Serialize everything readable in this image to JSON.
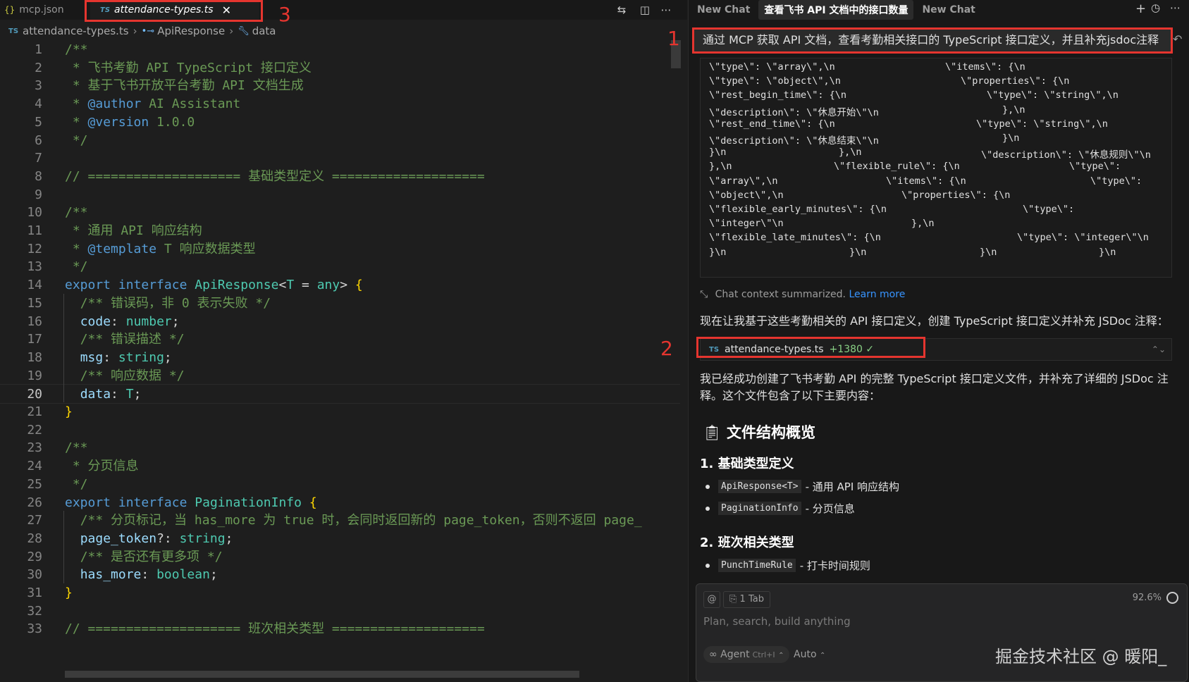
{
  "editor": {
    "tabs": [
      {
        "label": "mcp.json",
        "icon": "json-braces-icon"
      },
      {
        "label": "attendance-types.ts",
        "icon": "typescript-icon",
        "active": true
      }
    ],
    "tab_close": "✕",
    "icons": [
      "compare-changes-icon",
      "split-editor-icon",
      "more-actions-icon"
    ],
    "breadcrumb": {
      "file": "attendance-types.ts",
      "symbol1": "ApiResponse",
      "symbol2": "data",
      "ts_badge": "TS"
    },
    "current_line": 20,
    "lines": [
      {
        "n": 1,
        "tokens": [
          [
            "c",
            "/**"
          ]
        ]
      },
      {
        "n": 2,
        "tokens": [
          [
            "c",
            " * 飞书考勤 API TypeScript 接口定义"
          ]
        ]
      },
      {
        "n": 3,
        "tokens": [
          [
            "c",
            " * 基于飞书开放平台考勤 API 文档生成"
          ]
        ]
      },
      {
        "n": 4,
        "tokens": [
          [
            "c",
            " * "
          ],
          [
            "doc",
            "@author"
          ],
          [
            "c",
            " AI Assistant"
          ]
        ]
      },
      {
        "n": 5,
        "tokens": [
          [
            "c",
            " * "
          ],
          [
            "doc",
            "@version"
          ],
          [
            "c",
            " 1.0.0"
          ]
        ]
      },
      {
        "n": 6,
        "tokens": [
          [
            "c",
            " */"
          ]
        ]
      },
      {
        "n": 7,
        "tokens": []
      },
      {
        "n": 8,
        "tokens": [
          [
            "c",
            "// ==================== 基础类型定义 ===================="
          ]
        ]
      },
      {
        "n": 9,
        "tokens": []
      },
      {
        "n": 10,
        "tokens": [
          [
            "c",
            "/**"
          ]
        ]
      },
      {
        "n": 11,
        "tokens": [
          [
            "c",
            " * 通用 API 响应结构"
          ]
        ]
      },
      {
        "n": 12,
        "tokens": [
          [
            "c",
            " * "
          ],
          [
            "doc",
            "@template"
          ],
          [
            "c",
            " T 响应数据类型"
          ]
        ]
      },
      {
        "n": 13,
        "tokens": [
          [
            "c",
            " */"
          ]
        ]
      },
      {
        "n": 14,
        "tokens": [
          [
            "k",
            "export"
          ],
          [
            "p",
            " "
          ],
          [
            "k",
            "interface"
          ],
          [
            "p",
            " "
          ],
          [
            "t",
            "ApiResponse"
          ],
          [
            "p",
            "<"
          ],
          [
            "t",
            "T"
          ],
          [
            "p",
            " = "
          ],
          [
            "t",
            "any"
          ],
          [
            "p",
            "> "
          ],
          [
            "b",
            "{"
          ]
        ]
      },
      {
        "n": 15,
        "tokens": [
          [
            "p",
            "  "
          ],
          [
            "c",
            "/** 错误码，非 0 表示失败 */"
          ]
        ]
      },
      {
        "n": 16,
        "tokens": [
          [
            "p",
            "  "
          ],
          [
            "v",
            "code"
          ],
          [
            "p",
            ": "
          ],
          [
            "t",
            "number"
          ],
          [
            "p",
            ";"
          ]
        ]
      },
      {
        "n": 17,
        "tokens": [
          [
            "p",
            "  "
          ],
          [
            "c",
            "/** 错误描述 */"
          ]
        ]
      },
      {
        "n": 18,
        "tokens": [
          [
            "p",
            "  "
          ],
          [
            "v",
            "msg"
          ],
          [
            "p",
            ": "
          ],
          [
            "t",
            "string"
          ],
          [
            "p",
            ";"
          ]
        ]
      },
      {
        "n": 19,
        "tokens": [
          [
            "p",
            "  "
          ],
          [
            "c",
            "/** 响应数据 */"
          ]
        ]
      },
      {
        "n": 20,
        "tokens": [
          [
            "p",
            "  "
          ],
          [
            "v",
            "data"
          ],
          [
            "p",
            ": "
          ],
          [
            "t",
            "T"
          ],
          [
            "p",
            ";"
          ]
        ]
      },
      {
        "n": 21,
        "tokens": [
          [
            "b",
            "}"
          ]
        ]
      },
      {
        "n": 22,
        "tokens": []
      },
      {
        "n": 23,
        "tokens": [
          [
            "c",
            "/**"
          ]
        ]
      },
      {
        "n": 24,
        "tokens": [
          [
            "c",
            " * 分页信息"
          ]
        ]
      },
      {
        "n": 25,
        "tokens": [
          [
            "c",
            " */"
          ]
        ]
      },
      {
        "n": 26,
        "tokens": [
          [
            "k",
            "export"
          ],
          [
            "p",
            " "
          ],
          [
            "k",
            "interface"
          ],
          [
            "p",
            " "
          ],
          [
            "t",
            "PaginationInfo"
          ],
          [
            "p",
            " "
          ],
          [
            "b",
            "{"
          ]
        ]
      },
      {
        "n": 27,
        "tokens": [
          [
            "p",
            "  "
          ],
          [
            "c",
            "/** 分页标记，当 has_more 为 true 时，会同时返回新的 page_token，否则不返回 page_"
          ]
        ]
      },
      {
        "n": 28,
        "tokens": [
          [
            "p",
            "  "
          ],
          [
            "v",
            "page_token"
          ],
          [
            "p",
            "?: "
          ],
          [
            "t",
            "string"
          ],
          [
            "p",
            ";"
          ]
        ]
      },
      {
        "n": 29,
        "tokens": [
          [
            "p",
            "  "
          ],
          [
            "c",
            "/** 是否还有更多项 */"
          ]
        ]
      },
      {
        "n": 30,
        "tokens": [
          [
            "p",
            "  "
          ],
          [
            "v",
            "has_more"
          ],
          [
            "p",
            ": "
          ],
          [
            "t",
            "boolean"
          ],
          [
            "p",
            ";"
          ]
        ]
      },
      {
        "n": 31,
        "tokens": [
          [
            "b",
            "}"
          ]
        ]
      },
      {
        "n": 32,
        "tokens": []
      },
      {
        "n": 33,
        "tokens": [
          [
            "c",
            "// ==================== 班次相关类型 ===================="
          ]
        ]
      }
    ]
  },
  "annotations": {
    "n1": "1",
    "n2": "2",
    "n3": "3"
  },
  "chat": {
    "tabs": [
      {
        "label": "New Chat"
      },
      {
        "label": "查看飞书 API 文档中的接口数量",
        "active": true
      },
      {
        "label": "New Chat"
      }
    ],
    "icons": [
      "plus-icon",
      "history-icon",
      "more-icon"
    ],
    "prompt": "通过 MCP 获取 API 文档，查看考勤相关接口的 TypeScript 接口定义，并且补充jsdoc注释",
    "tool_output": [
      [
        [
          0,
          "\\\"type\\\": \\\"array\\\",\\n"
        ],
        [
          335,
          "\\\"items\\\": {\\n"
        ]
      ],
      [
        [
          0,
          "\\\"type\\\": \\\"object\\\",\\n"
        ],
        [
          357,
          "\\\"properties\\\": {\\n"
        ]
      ],
      [
        [
          0,
          "\\\"rest_begin_time\\\": {\\n"
        ],
        [
          394,
          "\\\"type\\\": \\\"string\\\",\\n"
        ]
      ],
      [
        [
          0,
          "\\\"description\\\": \\\"休息开始\\\"\\n"
        ],
        [
          416,
          "},\\n"
        ]
      ],
      [
        [
          0,
          "\\\"rest_end_time\\\": {\\n"
        ],
        [
          379,
          "\\\"type\\\": \\\"string\\\",\\n"
        ]
      ],
      [
        [
          0,
          "\\\"description\\\": \\\"休息结束\\\"\\n"
        ],
        [
          416,
          "}\\n"
        ]
      ],
      [
        [
          0,
          "}\\n"
        ],
        [
          184,
          "},\\n"
        ],
        [
          386,
          "\\\"description\\\": \\\"休息规则\\\"\\n"
        ]
      ],
      [
        [
          0,
          "},\\n"
        ],
        [
          177,
          "\\\"flexible_rule\\\": {\\n"
        ],
        [
          511,
          "\\\"type\\\":"
        ]
      ],
      [
        [
          0,
          "\\\"array\\\",\\n"
        ],
        [
          251,
          "\\\"items\\\": {\\n"
        ],
        [
          541,
          "\\\"type\\\":"
        ]
      ],
      [
        [
          0,
          "\\\"object\\\",\\n"
        ],
        [
          273,
          "\\\"properties\\\": {\\n"
        ]
      ],
      [
        [
          0,
          "\\\"flexible_early_minutes\\\": {\\n"
        ],
        [
          445,
          "\\\"type\\\":"
        ]
      ],
      [
        [
          0,
          "\\\"integer\\\"\\n"
        ],
        [
          287,
          "},\\n"
        ]
      ],
      [
        [
          0,
          "\\\"flexible_late_minutes\\\": {\\n"
        ],
        [
          437,
          "\\\"type\\\": \\\"integer\\\"\\n"
        ]
      ],
      [
        [
          0,
          "}\\n"
        ],
        [
          199,
          "}\\n"
        ],
        [
          384,
          "}\\n"
        ],
        [
          553,
          "}\\n"
        ]
      ]
    ],
    "summary_text": "Chat context summarized.",
    "summary_link": "Learn more",
    "intro": "现在让我基于这些考勤相关的 API 接口定义，创建 TypeScript 接口定义并补充 JSDoc 注释：",
    "file_pill": {
      "badge": "TS",
      "name": "attendance-types.ts",
      "added": "+1380",
      "check": "✓"
    },
    "done_text": "我已经成功创建了飞书考勤 API 的完整 TypeScript 接口定义文件，并补充了详细的 JSDoc 注释。这个文件包含了以下主要内容：",
    "heading": "文件结构概览",
    "sec1": "1. 基础类型定义",
    "sec1_items": [
      {
        "code": "ApiResponse<T>",
        "desc": "- 通用 API 响应结构"
      },
      {
        "code": "PaginationInfo",
        "desc": "- 分页信息"
      }
    ],
    "sec2": "2. 班次相关类型",
    "sec2_items": [
      {
        "code": "PunchTimeRule",
        "desc": "- 打卡时间规则"
      }
    ],
    "composer": {
      "at": "@",
      "tab_chip": "1 Tab",
      "percent": "92.6%",
      "placeholder": "Plan, search, build anything",
      "agent": "Agent",
      "agent_kbd": "Ctrl+I",
      "auto": "Auto"
    },
    "watermark": "掘金技术社区 @ 暖阳_"
  }
}
